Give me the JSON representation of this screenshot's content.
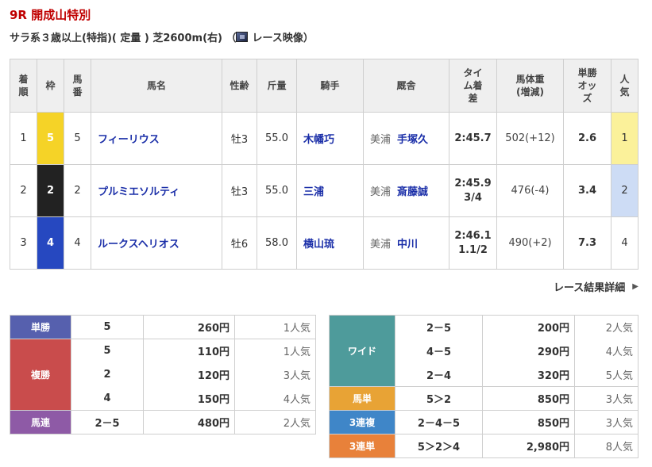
{
  "race": {
    "title": "9R 開成山特別",
    "info_prefix": "サラ系３歳以上(特指)( 定量 ) 芝2600m(右) （",
    "video_label": "レース映像",
    "info_suffix": "）"
  },
  "table_headers": {
    "rank": "着順",
    "waku": "枠",
    "umaban": "馬番",
    "horse": "馬名",
    "sexage": "性齢",
    "weight_carried": "斤量",
    "jockey": "騎手",
    "trainer": "厩舎",
    "time": "タイム着差",
    "body_weight": "馬体重(増減)",
    "odds": "単勝オッズ",
    "popularity": "人気"
  },
  "results": [
    {
      "rank": "1",
      "waku": "5",
      "umaban": "5",
      "horse": "フィーリウス",
      "sexage": "牡3",
      "kinryo": "55.0",
      "jockey": "木幡巧",
      "region": "美浦",
      "trainer": "手塚久",
      "time": "2:45.7",
      "margin": "",
      "body_weight": "502(+12)",
      "odds": "2.6",
      "pop": "1"
    },
    {
      "rank": "2",
      "waku": "2",
      "umaban": "2",
      "horse": "プルミエソルティ",
      "sexage": "牡3",
      "kinryo": "55.0",
      "jockey": "三浦",
      "region": "美浦",
      "trainer": "斎藤誠",
      "time": "2:45.9",
      "margin": "3/4",
      "body_weight": "476(-4)",
      "odds": "3.4",
      "pop": "2"
    },
    {
      "rank": "3",
      "waku": "4",
      "umaban": "4",
      "horse": "ルークスヘリオス",
      "sexage": "牡6",
      "kinryo": "58.0",
      "jockey": "横山琉",
      "region": "美浦",
      "trainer": "中川",
      "time": "2:46.1",
      "margin": "1.1/2",
      "body_weight": "490(+2)",
      "odds": "7.3",
      "pop": "4"
    }
  ],
  "colors": {
    "waku_5": "#f5d327",
    "waku_2": "#222222",
    "waku_4": "#2648c0",
    "pop_1_bg": "#fbf19a",
    "pop_2_bg": "#cddcf5",
    "tansho": "#5660ae",
    "fukusho": "#c94c4c",
    "umaren": "#8e5aa6",
    "wide": "#4e9b9b",
    "umatan": "#e8a335",
    "sanrenpuku": "#3f86c8",
    "sanrentan": "#e8813a"
  },
  "detail_link": "レース結果詳細",
  "payouts_left": {
    "tansho": {
      "label": "単勝",
      "rows": [
        {
          "combo": "5",
          "amount": "260円",
          "pop": "1人気"
        }
      ]
    },
    "fukusho": {
      "label": "複勝",
      "rows": [
        {
          "combo": "5",
          "amount": "110円",
          "pop": "1人気"
        },
        {
          "combo": "2",
          "amount": "120円",
          "pop": "3人気"
        },
        {
          "combo": "4",
          "amount": "150円",
          "pop": "4人気"
        }
      ]
    },
    "umaren": {
      "label": "馬連",
      "rows": [
        {
          "combo": "2－5",
          "amount": "480円",
          "pop": "2人気"
        }
      ]
    }
  },
  "payouts_right": {
    "wide": {
      "label": "ワイド",
      "rows": [
        {
          "combo": "2－5",
          "amount": "200円",
          "pop": "2人気"
        },
        {
          "combo": "4－5",
          "amount": "290円",
          "pop": "4人気"
        },
        {
          "combo": "2－4",
          "amount": "320円",
          "pop": "5人気"
        }
      ]
    },
    "umatan": {
      "label": "馬単",
      "rows": [
        {
          "combo": "5＞2",
          "amount": "850円",
          "pop": "3人気"
        }
      ]
    },
    "sanrenpuku": {
      "label": "3連複",
      "rows": [
        {
          "combo": "2－4－5",
          "amount": "850円",
          "pop": "3人気"
        }
      ]
    },
    "sanrentan": {
      "label": "3連単",
      "rows": [
        {
          "combo": "5＞2＞4",
          "amount": "2,980円",
          "pop": "8人気"
        }
      ]
    }
  }
}
